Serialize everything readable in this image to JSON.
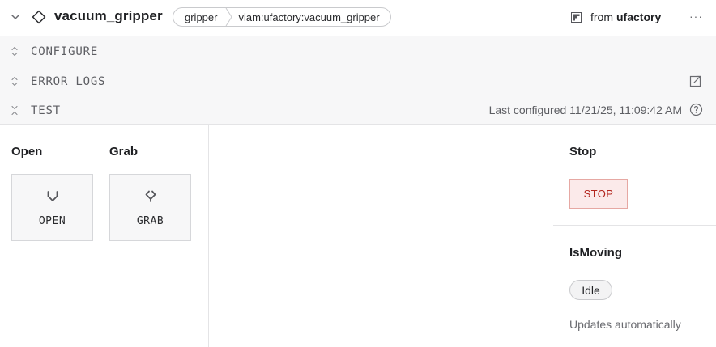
{
  "header": {
    "title": "vacuum_gripper",
    "breadcrumb": [
      "gripper",
      "viam:ufactory:vacuum_gripper"
    ],
    "from_prefix": "from",
    "from_name": "ufactory",
    "more": "···"
  },
  "sections": {
    "configure": "CONFIGURE",
    "error_logs": "ERROR LOGS",
    "test": "TEST",
    "last_configured": "Last configured 11/21/25, 11:09:42 AM"
  },
  "test_panel": {
    "open": {
      "heading": "Open",
      "button": "OPEN"
    },
    "grab": {
      "heading": "Grab",
      "button": "GRAB"
    },
    "stop": {
      "heading": "Stop",
      "button": "STOP"
    },
    "is_moving": {
      "heading": "IsMoving",
      "status": "Idle",
      "note": "Updates automatically"
    }
  },
  "colors": {
    "stop_text": "#b3261e",
    "stop_bg": "#fbeaea",
    "section_bg": "#f7f7f8"
  },
  "icons": [
    "chevron-down-icon",
    "diamond-icon",
    "module-icon",
    "more-icon",
    "expand-collapse-icon",
    "external-link-icon",
    "help-icon",
    "gripper-open-icon",
    "gripper-grab-icon"
  ]
}
